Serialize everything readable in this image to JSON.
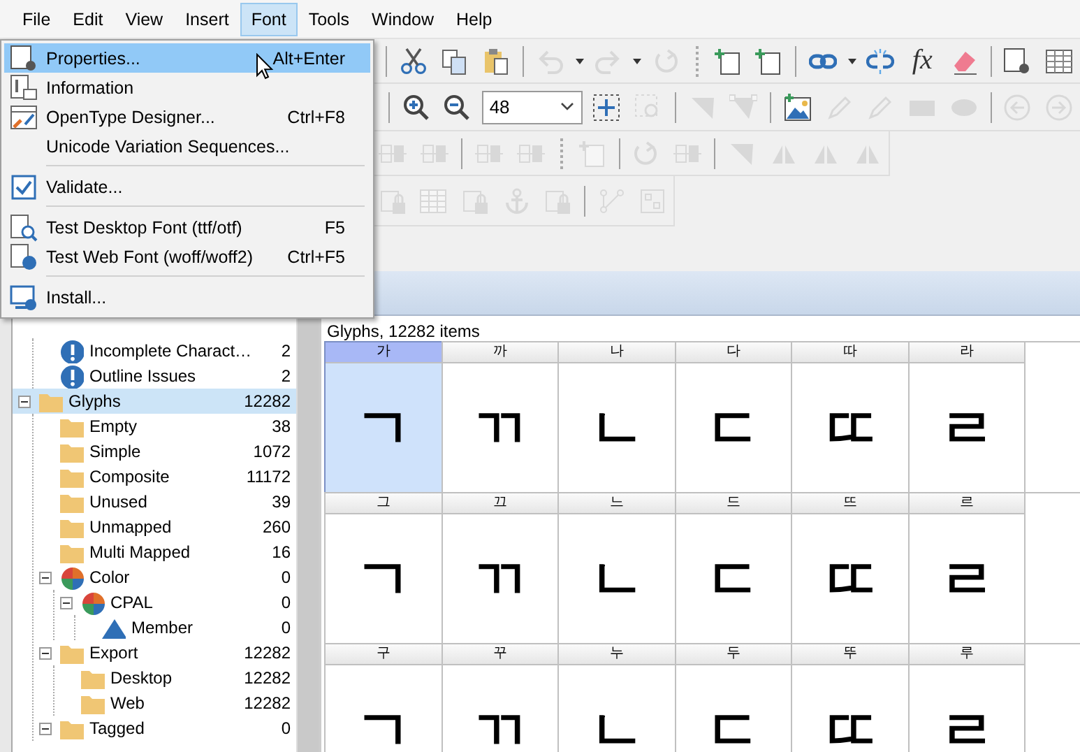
{
  "menubar": [
    {
      "label": "File",
      "selected": false
    },
    {
      "label": "Edit",
      "selected": false
    },
    {
      "label": "View",
      "selected": false
    },
    {
      "label": "Insert",
      "selected": false
    },
    {
      "label": "Font",
      "selected": true
    },
    {
      "label": "Tools",
      "selected": false
    },
    {
      "label": "Window",
      "selected": false
    },
    {
      "label": "Help",
      "selected": false
    }
  ],
  "font_menu": [
    {
      "kind": "properties",
      "label": "Properties...",
      "shortcut": "Alt+Enter",
      "selected": true
    },
    {
      "kind": "information",
      "label": "Information",
      "selected": false
    },
    {
      "kind": "designer",
      "label": "OpenType Designer...",
      "shortcut": "Ctrl+F8",
      "selected": false
    },
    {
      "kind": "plain",
      "label": "Unicode Variation Sequences...",
      "selected": false
    },
    {
      "kind": "separator"
    },
    {
      "kind": "validate",
      "label": "Validate...",
      "selected": false
    },
    {
      "kind": "separator"
    },
    {
      "kind": "test-desktop",
      "label": "Test Desktop Font (ttf/otf)",
      "shortcut": "F5",
      "selected": false
    },
    {
      "kind": "test-web",
      "label": "Test Web Font (woff/woff2)",
      "shortcut": "Ctrl+F5",
      "selected": false
    },
    {
      "kind": "separator"
    },
    {
      "kind": "install",
      "label": "Install...",
      "selected": false
    }
  ],
  "toolbars": [
    [
      {
        "kind": "sep"
      },
      {
        "kind": "cut",
        "disabled": false
      },
      {
        "kind": "copy",
        "disabled": false
      },
      {
        "kind": "paste",
        "disabled": false
      },
      {
        "kind": "sep"
      },
      {
        "kind": "undo",
        "disabled": true
      },
      {
        "kind": "caret",
        "disabled": false
      },
      {
        "kind": "redo",
        "disabled": true
      },
      {
        "kind": "caret",
        "disabled": false
      },
      {
        "kind": "refresh",
        "disabled": true
      },
      {
        "kind": "grip"
      },
      {
        "kind": "add-page",
        "disabled": false
      },
      {
        "kind": "add-page",
        "disabled": false
      },
      {
        "kind": "sep"
      },
      {
        "kind": "link",
        "disabled": false
      },
      {
        "kind": "caret",
        "disabled": false
      },
      {
        "kind": "unlink",
        "disabled": false
      },
      {
        "kind": "text",
        "label": "fx",
        "disabled": false
      },
      {
        "kind": "eraser",
        "disabled": false
      },
      {
        "kind": "sep"
      },
      {
        "kind": "page-gear",
        "disabled": false
      },
      {
        "kind": "table",
        "disabled": false
      }
    ],
    [
      {
        "kind": "sep"
      },
      {
        "kind": "zoom-in",
        "disabled": false
      },
      {
        "kind": "zoom-out",
        "disabled": false
      },
      {
        "kind": "combo",
        "value": "48"
      },
      {
        "kind": "fit",
        "disabled": false
      },
      {
        "kind": "zoom-area",
        "disabled": true
      },
      {
        "kind": "sep"
      },
      {
        "kind": "triangle",
        "disabled": true
      },
      {
        "kind": "vertices",
        "disabled": true
      },
      {
        "kind": "sep"
      },
      {
        "kind": "image",
        "disabled": false
      },
      {
        "kind": "pencil",
        "disabled": true
      },
      {
        "kind": "pencil",
        "disabled": true
      },
      {
        "kind": "rect",
        "disabled": true
      },
      {
        "kind": "ellipse",
        "disabled": true
      },
      {
        "kind": "sep"
      },
      {
        "kind": "left",
        "disabled": true
      },
      {
        "kind": "right",
        "disabled": true
      }
    ],
    [
      {
        "kind": "align",
        "disabled": true
      },
      {
        "kind": "align",
        "disabled": true
      },
      {
        "kind": "sep"
      },
      {
        "kind": "align",
        "disabled": true
      },
      {
        "kind": "align",
        "disabled": true
      },
      {
        "kind": "grip"
      },
      {
        "kind": "add-page",
        "disabled": true
      },
      {
        "kind": "sep"
      },
      {
        "kind": "refresh",
        "disabled": true
      },
      {
        "kind": "align",
        "disabled": true
      },
      {
        "kind": "sep"
      },
      {
        "kind": "triangle",
        "disabled": true
      },
      {
        "kind": "mirror",
        "disabled": true
      },
      {
        "kind": "mirror",
        "disabled": true
      },
      {
        "kind": "mirror",
        "disabled": true
      }
    ],
    [
      {
        "kind": "lock",
        "disabled": true
      },
      {
        "kind": "table",
        "disabled": true
      },
      {
        "kind": "lock",
        "disabled": true
      },
      {
        "kind": "anchor",
        "disabled": true
      },
      {
        "kind": "lock",
        "disabled": true
      },
      {
        "kind": "sep"
      },
      {
        "kind": "node",
        "disabled": true
      },
      {
        "kind": "grid",
        "disabled": true
      }
    ]
  ],
  "tree": {
    "partial_group_children": [
      {
        "kind": "warning",
        "label": "Incomplete Charact…",
        "count": "2",
        "selected": false
      },
      {
        "kind": "warning",
        "label": "Outline Issues",
        "count": "2",
        "selected": false
      }
    ],
    "items": [
      {
        "kind": "folder",
        "label": "Glyphs",
        "count": "12282",
        "selected": true,
        "expanded": true,
        "children": [
          {
            "kind": "folder",
            "label": "Empty",
            "count": "38",
            "selected": false
          },
          {
            "kind": "folder",
            "label": "Simple",
            "count": "1072",
            "selected": false
          },
          {
            "kind": "folder",
            "label": "Composite",
            "count": "11172",
            "selected": false
          },
          {
            "kind": "folder",
            "label": "Unused",
            "count": "39",
            "selected": false
          },
          {
            "kind": "folder",
            "label": "Unmapped",
            "count": "260",
            "selected": false
          },
          {
            "kind": "folder",
            "label": "Multi Mapped",
            "count": "16",
            "selected": false
          },
          {
            "kind": "palette",
            "label": "Color",
            "count": "0",
            "selected": false,
            "expanded": true,
            "children": [
              {
                "kind": "palette",
                "label": "CPAL",
                "count": "0",
                "selected": false,
                "expanded": true,
                "children": [
                  {
                    "kind": "triangle",
                    "label": "Member",
                    "count": "0",
                    "selected": false
                  }
                ]
              }
            ]
          },
          {
            "kind": "folder",
            "label": "Export",
            "count": "12282",
            "selected": false,
            "expanded": true,
            "children": [
              {
                "kind": "folder",
                "label": "Desktop",
                "count": "12282",
                "selected": false
              },
              {
                "kind": "folder",
                "label": "Web",
                "count": "12282",
                "selected": false
              }
            ]
          },
          {
            "kind": "folder",
            "label": "Tagged",
            "count": "0",
            "selected": false,
            "expanded": true
          }
        ]
      }
    ]
  },
  "glyph_grid": {
    "caption": "Glyphs, 12282 items",
    "rows": [
      [
        {
          "label": "가",
          "glyph": "ㄱ",
          "selected": true
        },
        {
          "label": "까",
          "glyph": "ㄲ",
          "selected": false
        },
        {
          "label": "나",
          "glyph": "ㄴ",
          "selected": false
        },
        {
          "label": "다",
          "glyph": "ㄷ",
          "selected": false
        },
        {
          "label": "따",
          "glyph": "ㄸ",
          "selected": false
        },
        {
          "label": "라",
          "glyph": "ㄹ",
          "selected": false
        }
      ],
      [
        {
          "label": "그",
          "glyph": "ㄱ",
          "selected": false
        },
        {
          "label": "끄",
          "glyph": "ㄲ",
          "selected": false
        },
        {
          "label": "느",
          "glyph": "ㄴ",
          "selected": false
        },
        {
          "label": "드",
          "glyph": "ㄷ",
          "selected": false
        },
        {
          "label": "뜨",
          "glyph": "ㄸ",
          "selected": false
        },
        {
          "label": "르",
          "glyph": "ㄹ",
          "selected": false
        }
      ],
      [
        {
          "label": "구",
          "glyph": "ㄱ",
          "selected": false
        },
        {
          "label": "꾸",
          "glyph": "ㄲ",
          "selected": false
        },
        {
          "label": "누",
          "glyph": "ㄴ",
          "selected": false
        },
        {
          "label": "두",
          "glyph": "ㄷ",
          "selected": false
        },
        {
          "label": "뚜",
          "glyph": "ㄸ",
          "selected": false
        },
        {
          "label": "루",
          "glyph": "ㄹ",
          "selected": false
        }
      ]
    ]
  }
}
